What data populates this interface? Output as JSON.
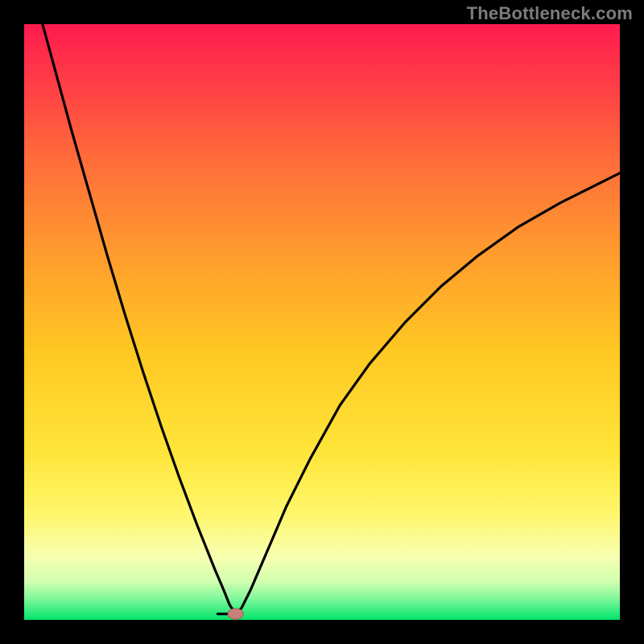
{
  "watermark": "TheBottleneck.com",
  "colors": {
    "frame": "#000000",
    "gradient_top": "#ff1a4f",
    "gradient_mid": "#ffd400",
    "gradient_low": "#f6ffb0",
    "gradient_bottom": "#00e56b",
    "curve": "#000000",
    "marker_fill": "#c97f7a",
    "marker_stroke": "#a55d57"
  },
  "chart_data": {
    "type": "line",
    "title": "",
    "xlabel": "",
    "ylabel": "",
    "xlim": [
      0,
      100
    ],
    "ylim": [
      0,
      100
    ],
    "grid": false,
    "legend": false,
    "series": [
      {
        "name": "bottleneck-curve",
        "x": [
          0,
          2,
          5,
          8,
          11,
          14,
          17,
          20,
          23,
          26,
          29,
          32,
          33.5,
          34.5,
          35.5,
          36.5,
          38,
          41,
          44,
          48,
          53,
          58,
          64,
          70,
          76,
          83,
          90,
          96,
          100
        ],
        "y": [
          112,
          104,
          93,
          82,
          71.5,
          61,
          51,
          41.5,
          32.5,
          24,
          16,
          8.5,
          5,
          2.5,
          1,
          2,
          5,
          12,
          19,
          27,
          36,
          43,
          50,
          56,
          61,
          66,
          70,
          73,
          75
        ]
      }
    ],
    "marker": {
      "x": 35.5,
      "y": 1,
      "rx": 1.3,
      "ry": 0.9
    },
    "notch": {
      "x_start": 32.5,
      "x_end": 35.0,
      "y": 1.0
    }
  }
}
